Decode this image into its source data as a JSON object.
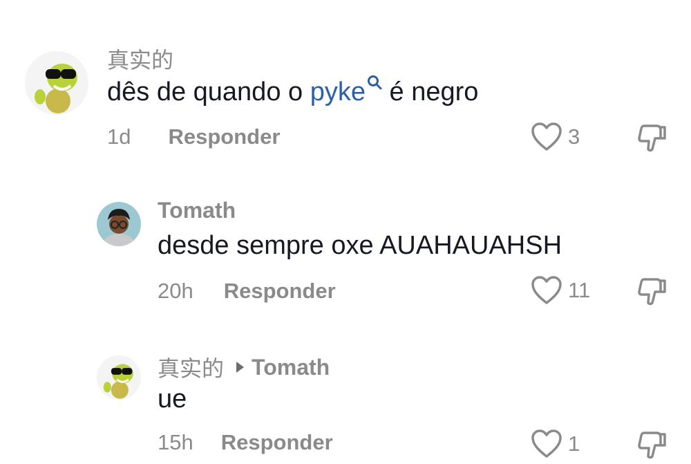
{
  "comments": [
    {
      "username": "真实的",
      "text_before": "dês de quando o ",
      "mention": "pyke",
      "text_after": " é negro",
      "time": "1d",
      "reply_label": "Responder",
      "likes": "3",
      "avatar": "turtle-sunglasses-avatar"
    },
    {
      "username": "Tomath",
      "text": "desde sempre oxe AUAHAUAHSH",
      "time": "20h",
      "reply_label": "Responder",
      "likes": "11",
      "avatar": "cartoon-boy-glasses-avatar"
    },
    {
      "username": "真实的",
      "reply_to": "Tomath",
      "text": "ue",
      "time": "15h",
      "reply_label": "Responder",
      "likes": "1",
      "avatar": "turtle-sunglasses-avatar"
    }
  ],
  "colors": {
    "text": "#161823",
    "muted": "#8a8a8a",
    "mention": "#2b5fa8"
  },
  "icons": [
    "heart-icon",
    "dislike-icon",
    "search-icon",
    "reply-arrow-icon"
  ]
}
